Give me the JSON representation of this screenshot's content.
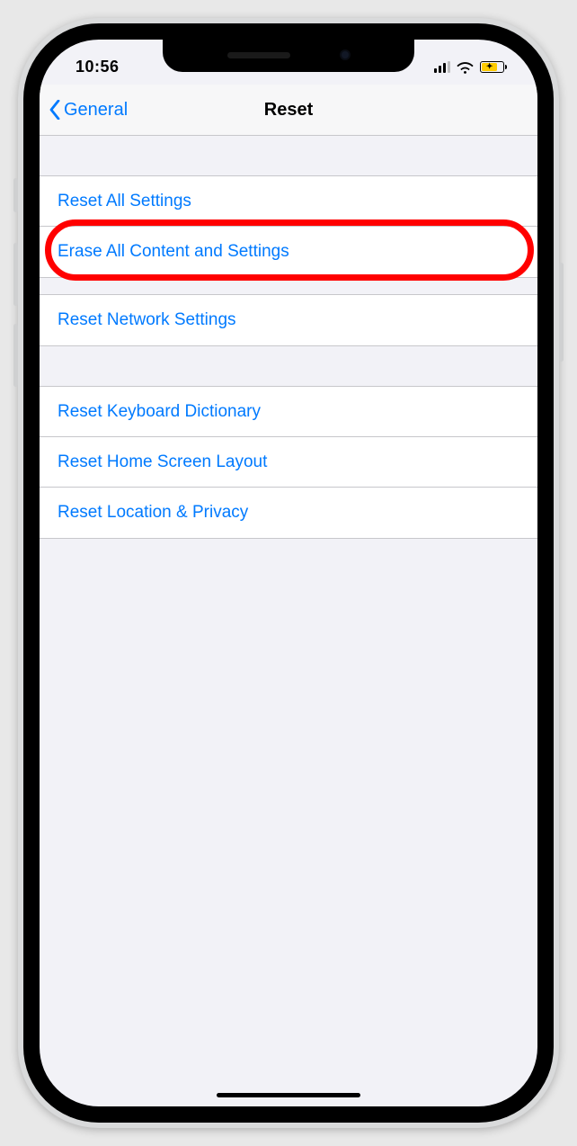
{
  "status": {
    "time": "10:56"
  },
  "nav": {
    "back_label": "General",
    "title": "Reset"
  },
  "sections": [
    {
      "items": [
        {
          "label": "Reset All Settings"
        },
        {
          "label": "Erase All Content and Settings"
        }
      ]
    },
    {
      "items": [
        {
          "label": "Reset Network Settings"
        }
      ]
    },
    {
      "items": [
        {
          "label": "Reset Keyboard Dictionary"
        },
        {
          "label": "Reset Home Screen Layout"
        },
        {
          "label": "Reset Location & Privacy"
        }
      ]
    }
  ],
  "highlight": {
    "section": 0,
    "item": 1
  }
}
